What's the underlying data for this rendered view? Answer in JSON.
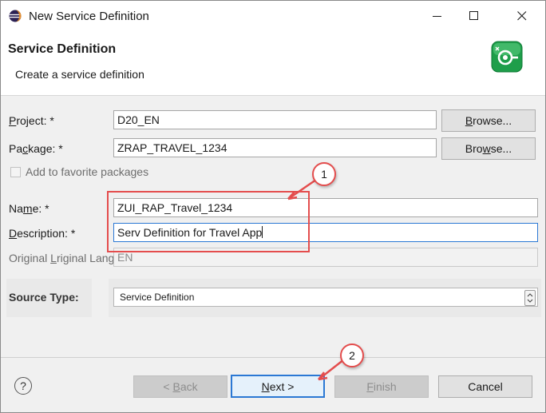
{
  "window": {
    "title": "New Service Definition",
    "minimize_label": "—",
    "maximize_label": "☐",
    "close_label": "✕"
  },
  "banner": {
    "title": "Service Definition",
    "subtitle": "Create a service definition"
  },
  "form": {
    "project_label": "Project: *",
    "project_value": "D20_EN",
    "package_label": "Package: *",
    "package_value": "ZRAP_TRAVEL_1234",
    "browse_label": "Browse...",
    "favorites_label": "Add to favorite packages",
    "name_label": "Name: *",
    "name_value": "ZUI_RAP_Travel_1234",
    "description_label": "Description: *",
    "description_value": "Serv Definition for Travel App",
    "language_label": "Original Language:",
    "language_value": "EN",
    "source_type_label": "Source Type:",
    "source_type_value": "Service Definition"
  },
  "footer": {
    "help_label": "?",
    "back_label": "< Back",
    "next_label": "Next >",
    "finish_label": "Finish",
    "cancel_label": "Cancel"
  },
  "callouts": {
    "one": "1",
    "two": "2"
  },
  "colors": {
    "accent": "#2b78d4",
    "annotation": "#e44d4d",
    "icon_green": "#1e9e4a"
  },
  "icons": {
    "app": "eclipse-icon",
    "banner": "service-definition-icon",
    "help": "help-icon",
    "dropdown": "dropdown-spinner-icon"
  }
}
